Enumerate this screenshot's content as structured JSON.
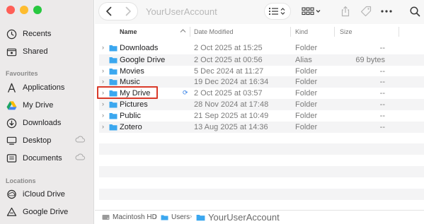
{
  "window": {
    "title": "YourUserAccount"
  },
  "sidebar": {
    "top_items": [
      {
        "label": "Recents",
        "icon": "clock-icon"
      },
      {
        "label": "Shared",
        "icon": "shared-folder-icon"
      }
    ],
    "favourites_label": "Favourites",
    "favourites": [
      {
        "label": "Applications",
        "icon": "applications-icon"
      },
      {
        "label": "My Drive",
        "icon": "google-drive-icon"
      },
      {
        "label": "Downloads",
        "icon": "download-icon"
      },
      {
        "label": "Desktop",
        "icon": "desktop-icon",
        "cloud": true
      },
      {
        "label": "Documents",
        "icon": "document-icon",
        "cloud": true
      }
    ],
    "locations_label": "Locations",
    "locations": [
      {
        "label": "iCloud Drive",
        "icon": "icloud-icon"
      },
      {
        "label": "Google Drive",
        "icon": "google-drive-icon"
      }
    ]
  },
  "columns": {
    "name": "Name",
    "date": "Date Modified",
    "kind": "Kind",
    "size": "Size"
  },
  "files": [
    {
      "name": "Downloads",
      "date": "2 Oct 2025 at 15:25",
      "kind": "Folder",
      "size": "--",
      "expandable": true
    },
    {
      "name": "Google Drive",
      "date": "2 Oct 2025 at 00:56",
      "kind": "Alias",
      "size": "69 bytes",
      "expandable": false
    },
    {
      "name": "Movies",
      "date": "5 Dec 2024 at 11:27",
      "kind": "Folder",
      "size": "--",
      "expandable": true
    },
    {
      "name": "Music",
      "date": "19 Dec 2024 at 16:34",
      "kind": "Folder",
      "size": "--",
      "expandable": true
    },
    {
      "name": "My Drive",
      "date": "2 Oct 2025 at 03:57",
      "kind": "Folder",
      "size": "--",
      "expandable": true,
      "highlighted": true,
      "syncing": true
    },
    {
      "name": "Pictures",
      "date": "28 Nov 2024 at 17:48",
      "kind": "Folder",
      "size": "--",
      "expandable": true
    },
    {
      "name": "Public",
      "date": "21 Sep 2025 at 10:49",
      "kind": "Folder",
      "size": "--",
      "expandable": true
    },
    {
      "name": "Zotero",
      "date": "13 Aug 2025 at 14:36",
      "kind": "Folder",
      "size": "--",
      "expandable": true
    }
  ],
  "pathbar": [
    "Macintosh HD",
    "Users",
    "YourUserAccount"
  ],
  "colors": {
    "folder": "#3ba7ef",
    "highlight": "#d93a2a",
    "sidebar_icon": "#2d2d2d"
  }
}
